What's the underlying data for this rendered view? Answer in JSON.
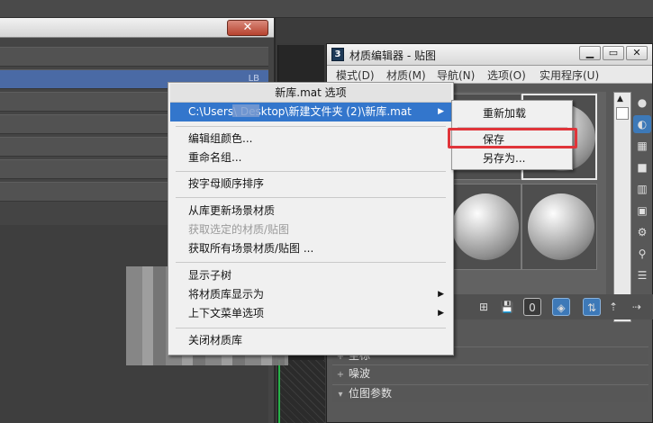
{
  "left_panel": {
    "close_glyph": "✕",
    "selected_row_tag": "LB"
  },
  "material_editor": {
    "logo_number": "3",
    "title": "材质编辑器 - 贴图",
    "window_buttons": {
      "minimize": "▁",
      "maximize": "▭",
      "close": "✕"
    },
    "menu": [
      {
        "label": "模式(D)"
      },
      {
        "label": "材质(M)"
      },
      {
        "label": "导航(N)"
      },
      {
        "label": "选项(O)"
      },
      {
        "label": "实用程序(U)"
      }
    ],
    "toolbar_badge": "0",
    "rollouts": [
      {
        "sign": "+",
        "label": "坐标"
      },
      {
        "sign": "+",
        "label": "噪波"
      },
      {
        "sign": "▾",
        "label": "位图参数"
      }
    ]
  },
  "context_menu": {
    "header": "新库.mat 选项",
    "path_item": "C:\\Users\\       Desktop\\新建文件夹 (2)\\新库.mat",
    "items": {
      "edit_group_color": "编辑组颜色...",
      "rename_group": "重命名组...",
      "sort_alpha": "按字母顺序排序",
      "update_from_library": "从库更新场景材质",
      "get_selected": "获取选定的材质/贴图",
      "get_all": "获取所有场景材质/贴图 ...",
      "show_subtree": "显示子树",
      "display_library_as": "将材质库显示为",
      "context_menu_options": "上下文菜单选项",
      "close_library": "关闭材质库"
    },
    "submenu_arrow": "▶"
  },
  "submenu": {
    "reload": "重新加载",
    "save": "保存",
    "save_as": "另存为..."
  }
}
